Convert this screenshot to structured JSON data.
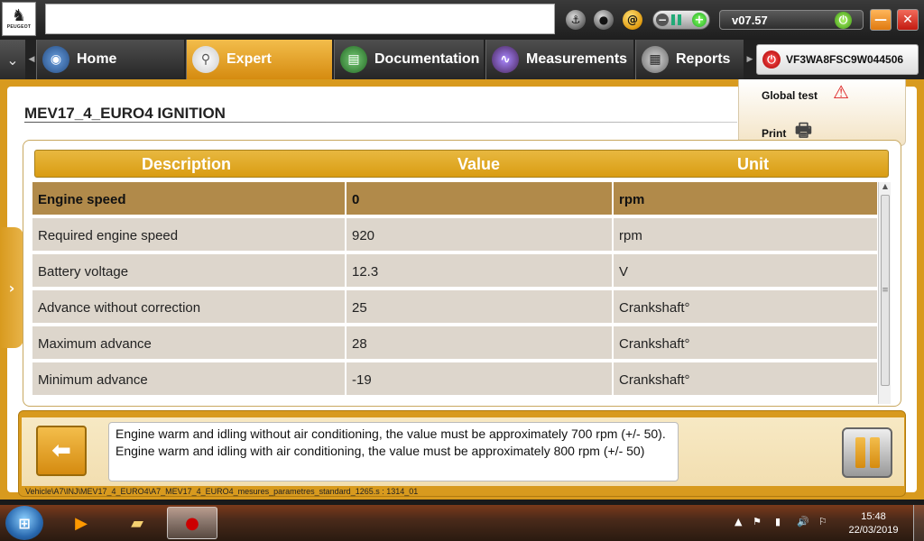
{
  "app": {
    "logo_text": "PEUGEOT",
    "version": "v07.57",
    "vin": "VF3WA8FSC9W044506"
  },
  "nav": {
    "tabs": [
      {
        "label": "Home",
        "active": false
      },
      {
        "label": "Expert",
        "active": true
      },
      {
        "label": "Documentation",
        "active": false
      },
      {
        "label": "Measurements",
        "active": false
      },
      {
        "label": "Reports",
        "active": false
      }
    ]
  },
  "page": {
    "title": "MEV17_4_EURO4  IGNITION"
  },
  "actions": {
    "global_test": "Global test",
    "print": "Print"
  },
  "table": {
    "columns": [
      "Description",
      "Value",
      "Unit"
    ],
    "rows": [
      {
        "description": "Engine speed",
        "value": "0",
        "unit": "rpm",
        "selected": true
      },
      {
        "description": "Required engine speed",
        "value": "920",
        "unit": "rpm",
        "selected": false
      },
      {
        "description": "Battery voltage",
        "value": "12.3",
        "unit": "V",
        "selected": false
      },
      {
        "description": "Advance without correction",
        "value": "25",
        "unit": "Crankshaft°",
        "selected": false
      },
      {
        "description": "Maximum advance",
        "value": "28",
        "unit": "Crankshaft°",
        "selected": false
      },
      {
        "description": "Minimum advance",
        "value": "-19",
        "unit": "Crankshaft°",
        "selected": false
      }
    ]
  },
  "info": {
    "text": "Engine warm and idling without air conditioning, the value must be approximately 700 rpm (+/- 50). Engine warm and idling with air conditioning, the value must be approximately 800 rpm (+/- 50)"
  },
  "footer": {
    "path": "Vehicle\\A7\\INJ\\MEV17_4_EURO4\\A7_MEV17_4_EURO4_mesures_parametres_standard_1265.s : 1314_01"
  },
  "taskbar": {
    "time": "15:48",
    "date": "22/03/2019"
  },
  "colors": {
    "accent": "#d89a1e",
    "selected_row": "#b18a4a",
    "row": "#ddd6cc"
  }
}
